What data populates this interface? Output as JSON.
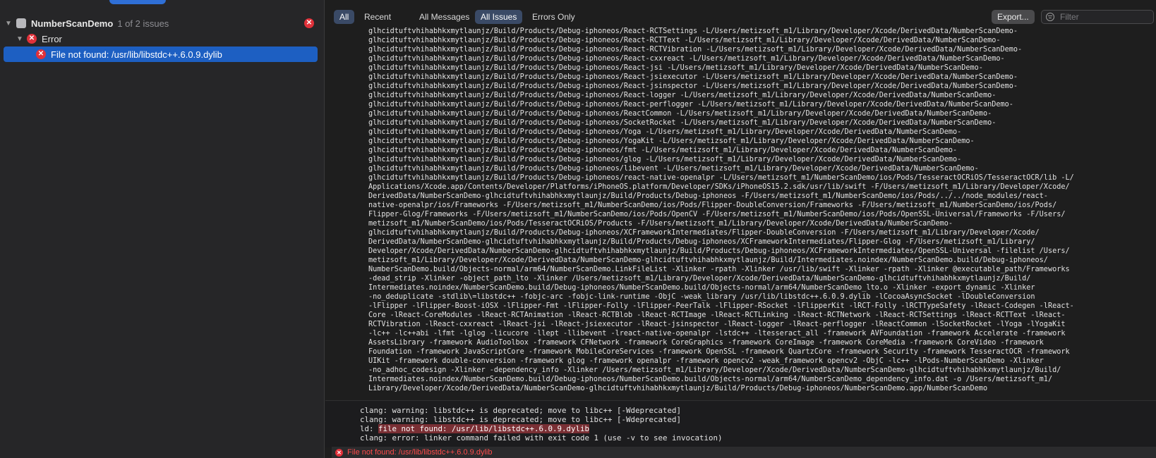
{
  "navigator": {
    "project_name": "NumberScanDemo",
    "issue_count": "1 of 2 issues",
    "group_label": "Error",
    "selected_issue": "File not found: /usr/lib/libstdc++.6.0.9.dylib"
  },
  "filter_bar": {
    "all": "All",
    "recent": "Recent",
    "all_messages": "All Messages",
    "all_issues": "All Issues",
    "errors_only": "Errors Only",
    "export": "Export...",
    "filter_placeholder": "Filter"
  },
  "log_lines": [
    "glhcidtuftvhihabhkxmytlaunjz/Build/Products/Debug-iphoneos/React-RCTSettings -L/Users/metizsoft_m1/Library/Developer/Xcode/DerivedData/NumberScanDemo-",
    "glhcidtuftvhihabhkxmytlaunjz/Build/Products/Debug-iphoneos/React-RCTText -L/Users/metizsoft_m1/Library/Developer/Xcode/DerivedData/NumberScanDemo-",
    "glhcidtuftvhihabhkxmytlaunjz/Build/Products/Debug-iphoneos/React-RCTVibration -L/Users/metizsoft_m1/Library/Developer/Xcode/DerivedData/NumberScanDemo-",
    "glhcidtuftvhihabhkxmytlaunjz/Build/Products/Debug-iphoneos/React-cxxreact -L/Users/metizsoft_m1/Library/Developer/Xcode/DerivedData/NumberScanDemo-",
    "glhcidtuftvhihabhkxmytlaunjz/Build/Products/Debug-iphoneos/React-jsi -L/Users/metizsoft_m1/Library/Developer/Xcode/DerivedData/NumberScanDemo-",
    "glhcidtuftvhihabhkxmytlaunjz/Build/Products/Debug-iphoneos/React-jsiexecutor -L/Users/metizsoft_m1/Library/Developer/Xcode/DerivedData/NumberScanDemo-",
    "glhcidtuftvhihabhkxmytlaunjz/Build/Products/Debug-iphoneos/React-jsinspector -L/Users/metizsoft_m1/Library/Developer/Xcode/DerivedData/NumberScanDemo-",
    "glhcidtuftvhihabhkxmytlaunjz/Build/Products/Debug-iphoneos/React-logger -L/Users/metizsoft_m1/Library/Developer/Xcode/DerivedData/NumberScanDemo-",
    "glhcidtuftvhihabhkxmytlaunjz/Build/Products/Debug-iphoneos/React-perflogger -L/Users/metizsoft_m1/Library/Developer/Xcode/DerivedData/NumberScanDemo-",
    "glhcidtuftvhihabhkxmytlaunjz/Build/Products/Debug-iphoneos/ReactCommon -L/Users/metizsoft_m1/Library/Developer/Xcode/DerivedData/NumberScanDemo-",
    "glhcidtuftvhihabhkxmytlaunjz/Build/Products/Debug-iphoneos/SocketRocket -L/Users/metizsoft_m1/Library/Developer/Xcode/DerivedData/NumberScanDemo-",
    "glhcidtuftvhihabhkxmytlaunjz/Build/Products/Debug-iphoneos/Yoga -L/Users/metizsoft_m1/Library/Developer/Xcode/DerivedData/NumberScanDemo-",
    "glhcidtuftvhihabhkxmytlaunjz/Build/Products/Debug-iphoneos/YogaKit -L/Users/metizsoft_m1/Library/Developer/Xcode/DerivedData/NumberScanDemo-",
    "glhcidtuftvhihabhkxmytlaunjz/Build/Products/Debug-iphoneos/fmt -L/Users/metizsoft_m1/Library/Developer/Xcode/DerivedData/NumberScanDemo-",
    "glhcidtuftvhihabhkxmytlaunjz/Build/Products/Debug-iphoneos/glog -L/Users/metizsoft_m1/Library/Developer/Xcode/DerivedData/NumberScanDemo-",
    "glhcidtuftvhihabhkxmytlaunjz/Build/Products/Debug-iphoneos/libevent -L/Users/metizsoft_m1/Library/Developer/Xcode/DerivedData/NumberScanDemo-",
    "glhcidtuftvhihabhkxmytlaunjz/Build/Products/Debug-iphoneos/react-native-openalpr -L/Users/metizsoft_m1/NumberScanDemo/ios/Pods/TesseractOCRiOS/TesseractOCR/lib -L/",
    "Applications/Xcode.app/Contents/Developer/Platforms/iPhoneOS.platform/Developer/SDKs/iPhoneOS15.2.sdk/usr/lib/swift -F/Users/metizsoft_m1/Library/Developer/Xcode/",
    "DerivedData/NumberScanDemo-glhcidtuftvhihabhkxmytlaunjz/Build/Products/Debug-iphoneos -F/Users/metizsoft_m1/NumberScanDemo/ios/Pods/../../node_modules/react-",
    "native-openalpr/ios/Frameworks -F/Users/metizsoft_m1/NumberScanDemo/ios/Pods/Flipper-DoubleConversion/Frameworks -F/Users/metizsoft_m1/NumberScanDemo/ios/Pods/",
    "Flipper-Glog/Frameworks -F/Users/metizsoft_m1/NumberScanDemo/ios/Pods/OpenCV -F/Users/metizsoft_m1/NumberScanDemo/ios/Pods/OpenSSL-Universal/Frameworks -F/Users/",
    "metizsoft_m1/NumberScanDemo/ios/Pods/TesseractOCRiOS/Products -F/Users/metizsoft_m1/Library/Developer/Xcode/DerivedData/NumberScanDemo-",
    "glhcidtuftvhihabhkxmytlaunjz/Build/Products/Debug-iphoneos/XCFrameworkIntermediates/Flipper-DoubleConversion -F/Users/metizsoft_m1/Library/Developer/Xcode/",
    "DerivedData/NumberScanDemo-glhcidtuftvhihabhkxmytlaunjz/Build/Products/Debug-iphoneos/XCFrameworkIntermediates/Flipper-Glog -F/Users/metizsoft_m1/Library/",
    "Developer/Xcode/DerivedData/NumberScanDemo-glhcidtuftvhihabhkxmytlaunjz/Build/Products/Debug-iphoneos/XCFrameworkIntermediates/OpenSSL-Universal -filelist /Users/",
    "metizsoft_m1/Library/Developer/Xcode/DerivedData/NumberScanDemo-glhcidtuftvhihabhkxmytlaunjz/Build/Intermediates.noindex/NumberScanDemo.build/Debug-iphoneos/",
    "NumberScanDemo.build/Objects-normal/arm64/NumberScanDemo.LinkFileList -Xlinker -rpath -Xlinker /usr/lib/swift -Xlinker -rpath -Xlinker @executable_path/Frameworks",
    "-dead_strip -Xlinker -object_path_lto -Xlinker /Users/metizsoft_m1/Library/Developer/Xcode/DerivedData/NumberScanDemo-glhcidtuftvhihabhkxmytlaunjz/Build/",
    "Intermediates.noindex/NumberScanDemo.build/Debug-iphoneos/NumberScanDemo.build/Objects-normal/arm64/NumberScanDemo_lto.o -Xlinker -export_dynamic -Xlinker",
    "-no_deduplicate -stdlib\\=libstdc++ -fobjc-arc -fobjc-link-runtime -ObjC -weak_library /usr/lib/libstdc++.6.0.9.dylib -lCocoaAsyncSocket -lDoubleConversion",
    "-lFlipper -lFlipper-Boost-iOSX -lFlipper-Fmt -lFlipper-Folly -lFlipper-PeerTalk -lFlipper-RSocket -lFlipperKit -lRCT-Folly -lRCTTypeSafety -lReact-Codegen -lReact-",
    "Core -lReact-CoreModules -lReact-RCTAnimation -lReact-RCTBlob -lReact-RCTImage -lReact-RCTLinking -lReact-RCTNetwork -lReact-RCTSettings -lReact-RCTText -lReact-",
    "RCTVibration -lReact-cxxreact -lReact-jsi -lReact-jsiexecutor -lReact-jsinspector -lReact-logger -lReact-perflogger -lReactCommon -lSocketRocket -lYoga -lYogaKit",
    "-lc++ -lc++abi -lfmt -lglog -licucore -llept -llibevent -lreact-native-openalpr -lstdc++ -ltesseract_all -framework AVFoundation -framework Accelerate -framework",
    "AssetsLibrary -framework AudioToolbox -framework CFNetwork -framework CoreGraphics -framework CoreImage -framework CoreMedia -framework CoreVideo -framework",
    "Foundation -framework JavaScriptCore -framework MobileCoreServices -framework OpenSSL -framework QuartzCore -framework Security -framework TesseractOCR -framework",
    "UIKit -framework double-conversion -framework glog -framework openalpr -framework opencv2 -weak_framework opencv2 -ObjC -lc++ -lPods-NumberScanDemo -Xlinker",
    "-no_adhoc_codesign -Xlinker -dependency_info -Xlinker /Users/metizsoft_m1/Library/Developer/Xcode/DerivedData/NumberScanDemo-glhcidtuftvhihabhkxmytlaunjz/Build/",
    "Intermediates.noindex/NumberScanDemo.build/Debug-iphoneos/NumberScanDemo.build/Objects-normal/arm64/NumberScanDemo_dependency_info.dat -o /Users/metizsoft_m1/",
    "Library/Developer/Xcode/DerivedData/NumberScanDemo-glhcidtuftvhihabhkxmytlaunjz/Build/Products/Debug-iphoneos/NumberScanDemo.app/NumberScanDemo"
  ],
  "summary": {
    "warning_1": "clang: warning: libstdc++ is deprecated; move to libc++ [-Wdeprecated]",
    "warning_2": "clang: warning: libstdc++ is deprecated; move to libc++ [-Wdeprecated]",
    "ld_prefix": "ld: ",
    "ld_error": "file not found: /usr/lib/libstdc++.6.0.9.dylib",
    "clang_error": "clang: error: linker command failed with exit code 1 (use -v to see invocation)"
  },
  "bottom_bar": {
    "message": "File not found: /usr/lib/libstdc++.6.0.9.dylib"
  },
  "icons": {
    "error": "error-x-icon",
    "disclosure": "chevron-down-icon",
    "project": "project-icon",
    "filter": "filter-icon"
  },
  "colors": {
    "error_red": "#e0313a",
    "selection_blue": "#1d5fc2",
    "highlight_red": "#7a2f34"
  }
}
